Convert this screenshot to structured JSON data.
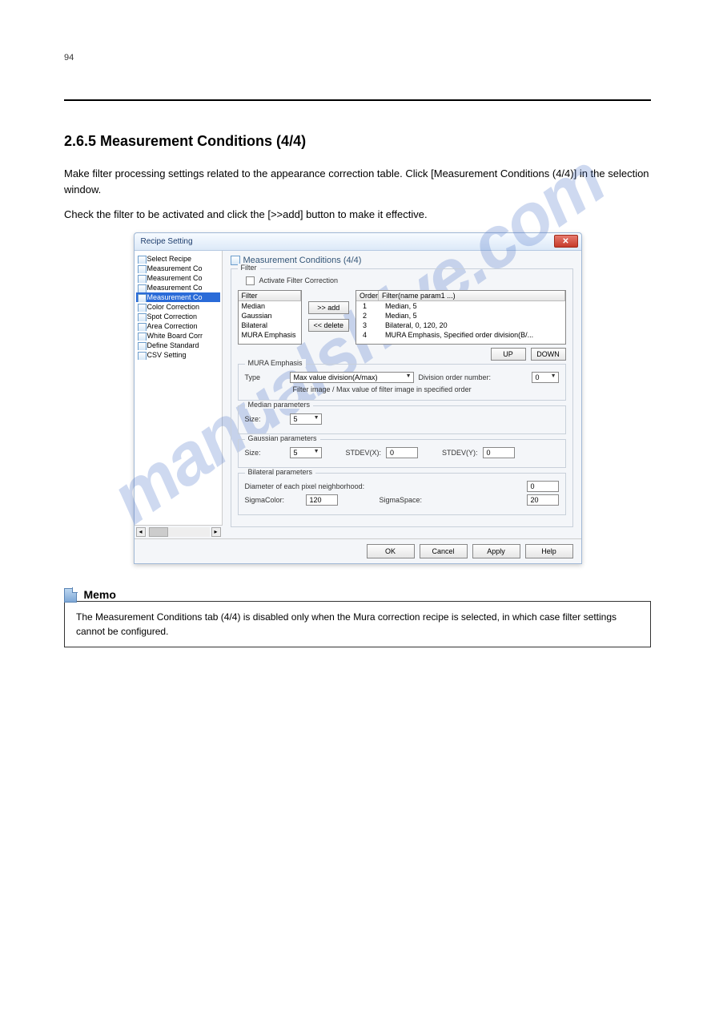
{
  "page": {
    "number": "94",
    "section_title": "2.6.5 Measurement Conditions (4/4)",
    "intro_1": "Make filter processing settings related to the appearance correction table. Click [Measurement Conditions (4/4)] in the selection window.",
    "intro_2": "Check the filter to be activated and click the [>>add] button to make it effective.",
    "watermark": "manualshive.com"
  },
  "dialog": {
    "title": "Recipe Setting",
    "tree": {
      "items": [
        "Select Recipe",
        "Measurement Co",
        "Measurement Co",
        "Measurement Co",
        "Measurement Co",
        "Color Correction",
        "Spot Correction",
        "Area Correction",
        "White Board Corr",
        "Define Standard",
        "CSV Setting"
      ],
      "selected_index": 4
    },
    "content": {
      "title": "Measurement Conditions (4/4)",
      "filter_group": "Filter",
      "activate_label": "Activate Filter Correction",
      "filter_header": "Filter",
      "filter_list": [
        "Median",
        "Gaussian",
        "Bilateral",
        "MURA Emphasis"
      ],
      "add_btn": ">> add",
      "delete_btn": "<< delete",
      "order_col1": "Order",
      "order_col2": "Filter(name param1 ...)",
      "order_list": [
        {
          "order": "1",
          "filter": "Median,  5"
        },
        {
          "order": "2",
          "filter": "Median,  5"
        },
        {
          "order": "3",
          "filter": "Bilateral,  0,  120,  20"
        },
        {
          "order": "4",
          "filter": "MURA Emphasis, Specified order division(B/..."
        }
      ],
      "up_btn": "UP",
      "down_btn": "DOWN"
    },
    "mura": {
      "legend": "MURA Emphasis",
      "type_label": "Type",
      "type_value": "Max value division(A/max)",
      "div_label": "Division order number:",
      "div_value": "0",
      "hint": "Filter image / Max value of filter image in specified order"
    },
    "median": {
      "legend": "Median parameters",
      "size_label": "Size:",
      "size_value": "5"
    },
    "gaussian": {
      "legend": "Gaussian parameters",
      "size_label": "Size:",
      "size_value": "5",
      "stdevx_label": "STDEV(X):",
      "stdevx_value": "0",
      "stdevy_label": "STDEV(Y):",
      "stdevy_value": "0"
    },
    "bilateral": {
      "legend": "Bilateral parameters",
      "diameter_label": "Diameter of each pixel neighborhood:",
      "diameter_value": "0",
      "sigma_color_label": "SigmaColor:",
      "sigma_color_value": "120",
      "sigma_space_label": "SigmaSpace:",
      "sigma_space_value": "20"
    },
    "footer": {
      "ok": "OK",
      "cancel": "Cancel",
      "apply": "Apply",
      "help": "Help"
    }
  },
  "memo": {
    "label": "Memo",
    "text": "The Measurement Conditions tab (4/4) is disabled only when the Mura correction recipe is selected, in which case filter settings cannot be configured."
  }
}
